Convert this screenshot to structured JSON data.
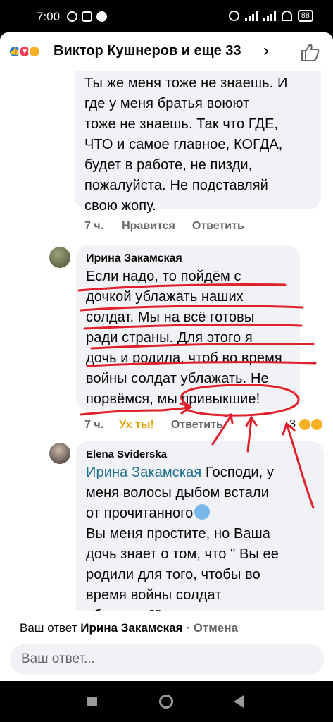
{
  "status_bar": {
    "time": "7:00",
    "battery": "88"
  },
  "header": {
    "title": "Виктор Кушнеров и еще 33",
    "chevron": "›",
    "reaction_icons": [
      "like-icon",
      "love-icon",
      "wow-icon"
    ]
  },
  "comments": [
    {
      "author": "",
      "text": "Ты же меня тоже не знаешь. И\nгде у меня братья воюют\nтоже не  знаешь.  Так что ГДЕ,\nЧТО и самое главное, КОГДА,\nбудет  в работе, не пизди,\nпожалуйста. Не подставляй\nсвою жопу.",
      "time": "7 ч.",
      "like_label": "Нравится",
      "reply_label": "Ответить"
    },
    {
      "author": "Ирина Закамская",
      "text": "Если надо, то пойдём с\nдочкой ублажать наших\nсолдат. Мы на всё готовы\nради  страны. Для этого я\nдочь и родила, чтоб во время\nвойны солдат ублажать. Не\nпорвёмся, мы привыкшие!",
      "time": "7 ч.",
      "reaction_label": "Ух ты!",
      "reply_label": "Ответить",
      "reaction_count": "3"
    },
    {
      "author": "Elena Sviderska",
      "mention": "Ирина Закамская",
      "text_after_mention": " Господи, у\nменя волосы дыбом встали\nот прочитанного",
      "text_rest": "Вы меня простите, но Ваша\nдочь знает о том, что \" Вы ее\nродили для того, чтобы во\nвремя войны солдат\nублажать?\""
    }
  ],
  "reply_bar": {
    "prefix": "Ваш ответ ",
    "target": "Ирина Закамская",
    "separator": " · ",
    "cancel": "Отмена",
    "placeholder": "Ваш ответ..."
  },
  "annotation_color": "#e0202a"
}
